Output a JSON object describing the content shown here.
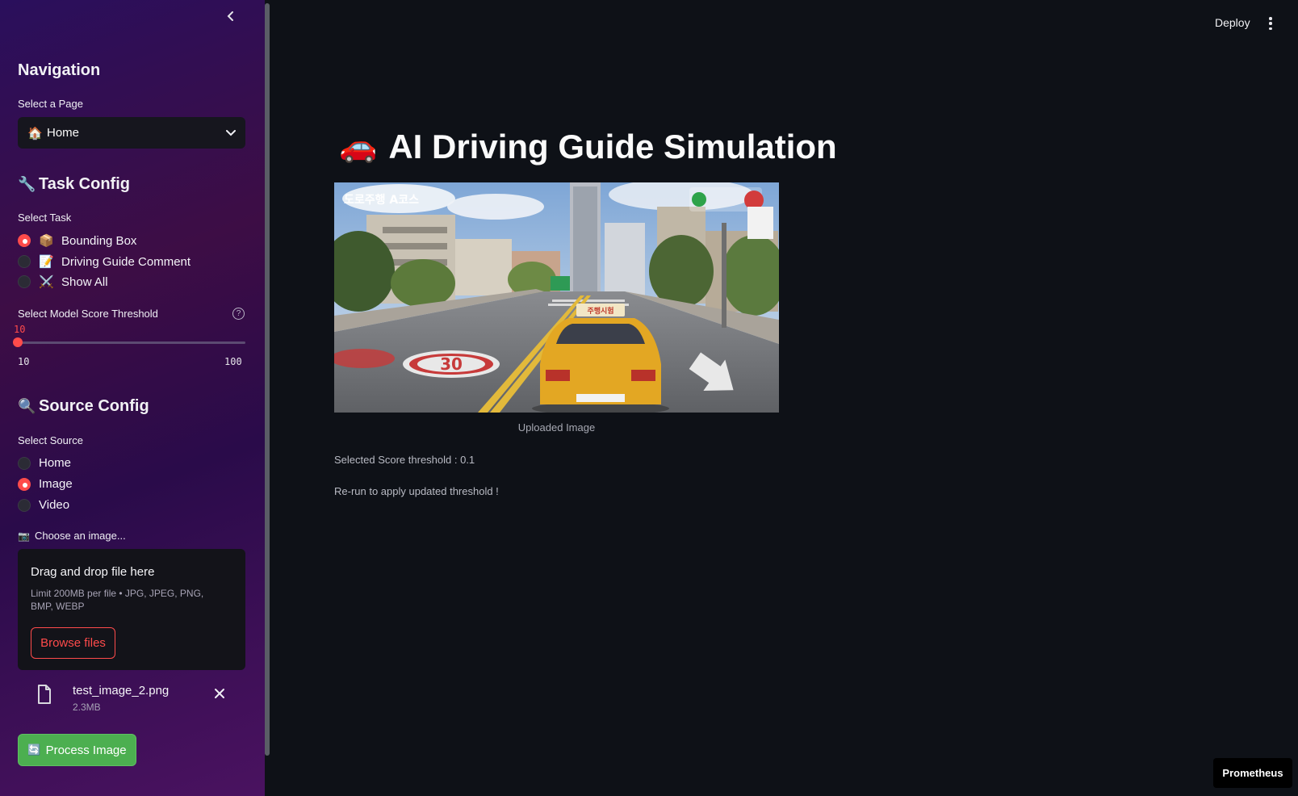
{
  "sidebar": {
    "navigation_heading": "Navigation",
    "page_select_label": "Select a Page",
    "page_select_value": "Home",
    "page_select_icon": "house-emoji",
    "task_config_heading": "Task Config",
    "select_task_label": "Select Task",
    "tasks": [
      {
        "label": "Bounding Box",
        "icon": "📦",
        "selected": true
      },
      {
        "label": "Driving Guide Comment",
        "icon": "📝",
        "selected": false
      },
      {
        "label": "Show All",
        "icon": "⚔️",
        "selected": false
      }
    ],
    "threshold_label": "Select Model Score Threshold",
    "threshold_value": "10",
    "threshold_min": "10",
    "threshold_max": "100",
    "source_config_heading": "Source Config",
    "select_source_label": "Select Source",
    "sources": [
      {
        "label": "Home",
        "selected": false
      },
      {
        "label": "Image",
        "selected": true
      },
      {
        "label": "Video",
        "selected": false
      }
    ],
    "upload_label": "Choose an image...",
    "dropzone_title": "Drag and drop file here",
    "dropzone_limits": "Limit 200MB per file • JPG, JPEG, PNG, BMP, WEBP",
    "browse_label": "Browse files",
    "file_name": "test_image_2.png",
    "file_size": "2.3MB",
    "process_label": "Process Image"
  },
  "header": {
    "deploy_label": "Deploy"
  },
  "main": {
    "title": "AI Driving Guide Simulation",
    "image_overlay_text": "도로주행 A코스",
    "speed_marking": "30",
    "taxi_sign": "주행시험",
    "image_caption": "Uploaded Image",
    "threshold_info": "Selected Score threshold : 0.1",
    "rerun_info": "Re-run to apply updated threshold !"
  },
  "badge": {
    "label": "Prometheus"
  },
  "colors": {
    "accent": "#ff4b4b",
    "background": "#0e1117",
    "process_button": "#4caf50"
  }
}
